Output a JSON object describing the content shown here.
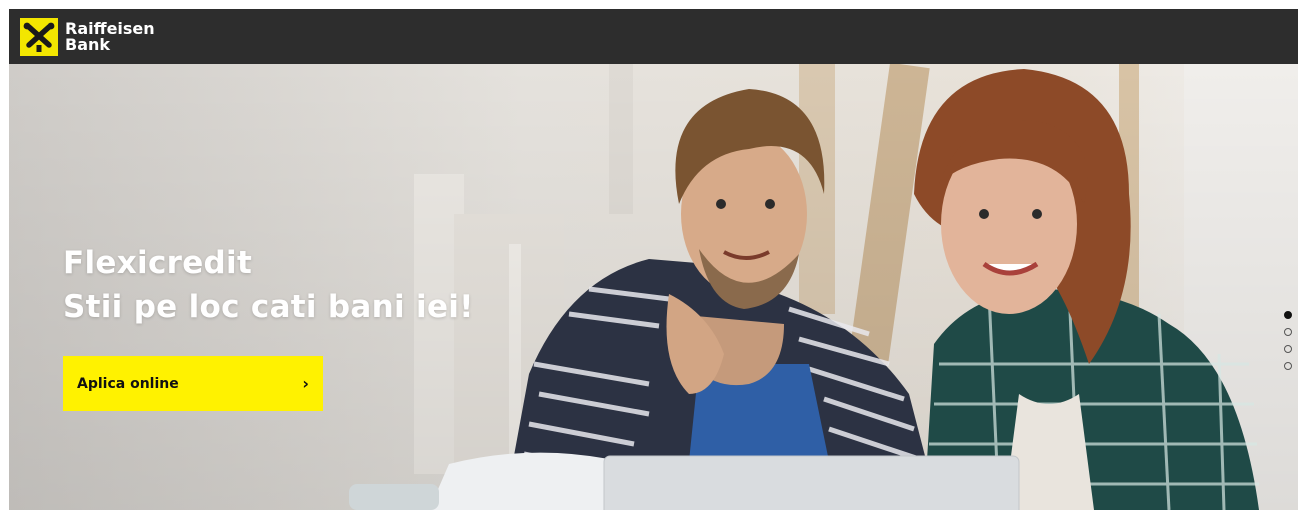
{
  "header": {
    "logo_line1": "Raiffeisen",
    "logo_line2": "Bank",
    "bg_color": "#2d2d2d",
    "logo_color": "#f3e600"
  },
  "hero": {
    "title": "Flexicredit",
    "subtitle": "Stii pe loc cati bani iei!",
    "cta_label": "Aplica online",
    "cta_icon": "chevron-right-icon",
    "cta_color": "#fff200",
    "image_alt": "photo-couple-smiling-at-laptop"
  },
  "carousel": {
    "slide_count": 4,
    "active_index": 0
  }
}
